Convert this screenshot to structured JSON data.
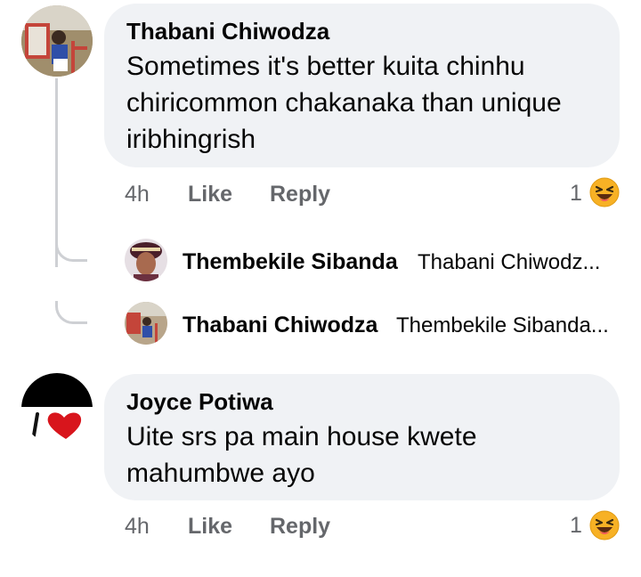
{
  "comments": [
    {
      "author": "Thabani Chiwodza",
      "text_lines": [
        "Sometimes it's better kuita chinhu",
        "chiricommon chakanaka than unique",
        "iribhingrish"
      ],
      "time": "4h",
      "like_label": "Like",
      "reply_label": "Reply",
      "reaction_count": "1",
      "reaction_icon": "laughing-emoji-icon",
      "replies": [
        {
          "author": "Thembekile Sibanda",
          "preview": "Thabani Chiwodz..."
        },
        {
          "author": "Thabani Chiwodza",
          "preview": "Thembekile Sibanda..."
        }
      ]
    },
    {
      "author": "Joyce Potiwa",
      "text_lines": [
        "Uite srs pa main house kwete",
        "mahumbwe ayo"
      ],
      "time": "4h",
      "like_label": "Like",
      "reply_label": "Reply",
      "reaction_count": "1",
      "reaction_icon": "laughing-emoji-icon"
    }
  ],
  "colors": {
    "bubble": "#f0f2f5",
    "meta_text": "#65676b",
    "thread_line": "#ced0d4",
    "emoji": "#f7b125"
  }
}
